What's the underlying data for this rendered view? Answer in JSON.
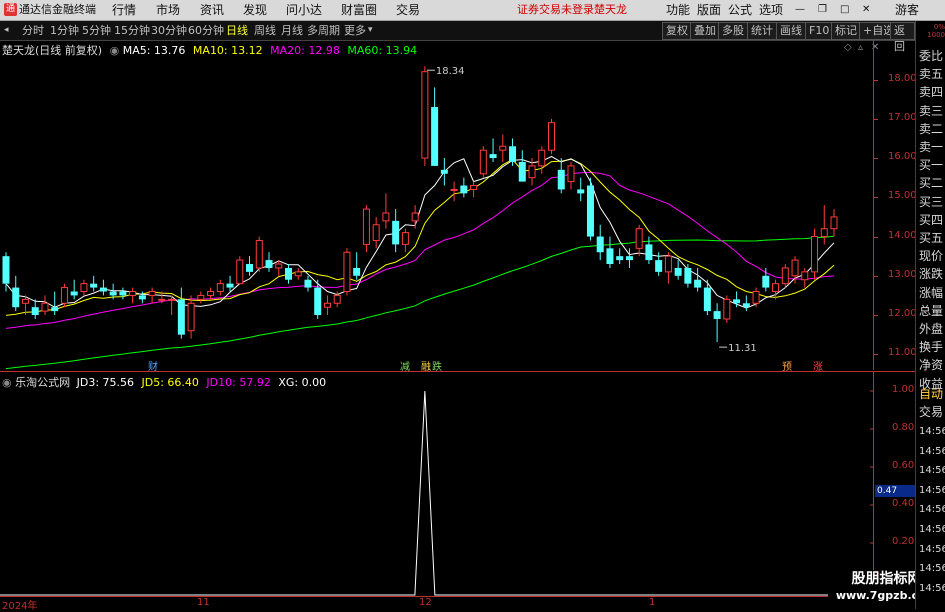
{
  "menubar": {
    "app_title": "通达信金融终端",
    "items": [
      "行情",
      "市场",
      "资讯",
      "发现",
      "问小达",
      "财富圈",
      "交易"
    ],
    "warning": "证券交易未登录",
    "stock": "楚天龙",
    "right_items": [
      "功能",
      "版面",
      "公式",
      "选项"
    ],
    "extra": "游客"
  },
  "toolbar": {
    "periods": [
      "分时",
      "1分钟",
      "5分钟",
      "15分钟",
      "30分钟",
      "60分钟",
      "日线",
      "周线",
      "月线",
      "多周期",
      "更多"
    ],
    "active_period": "日线",
    "right_buttons": [
      "复权",
      "叠加",
      "多股",
      "统计",
      "画线",
      "F10",
      "标记",
      "+自选",
      "返回"
    ]
  },
  "chart_header": {
    "name": "楚天龙(日线 前复权)",
    "ma5": "MA5: 13.76",
    "ma10": "MA10: 13.12",
    "ma20": "MA20: 12.98",
    "ma60": "MA60: 13.94",
    "colors": {
      "ma5": "#ffffff",
      "ma10": "#ffff00",
      "ma20": "#ff00ff",
      "ma60": "#00ff00"
    }
  },
  "indicator_header": {
    "name": "乐淘公式网",
    "jd3": "JD3: 75.56",
    "jd5": "JD5: 66.40",
    "jd10": "JD10: 57.92",
    "xg": "XG: 0.00",
    "colors": {
      "jd3": "#ffffff",
      "jd5": "#ffff00",
      "jd10": "#ff00ff",
      "xg": "#ffffff"
    }
  },
  "price_axis": [
    "18.00",
    "17.00",
    "16.00",
    "15.00",
    "14.00",
    "13.00",
    "12.00",
    "11.00"
  ],
  "indicator_axis": [
    "1.00",
    "0.80",
    "0.60",
    "0.40",
    "0.20"
  ],
  "indicator_current": "0.47",
  "annotations": {
    "high": "18.34",
    "low": "11.31"
  },
  "event_markers": [
    {
      "text": "财",
      "color": "#4fa3ff"
    },
    {
      "text": "减",
      "color": "#7cd95f"
    },
    {
      "text": "融",
      "color": "#ffd24a"
    },
    {
      "text": "跌",
      "color": "#7cd95f"
    },
    {
      "text": "预",
      "color": "#ff9f3c"
    },
    {
      "text": "涨",
      "color": "#ff4040"
    }
  ],
  "date_axis": [
    "2024年",
    "11",
    "12",
    "1"
  ],
  "right_panel": {
    "labels": [
      "委比",
      "卖五",
      "卖四",
      "卖三",
      "卖二",
      "卖一",
      "买一",
      "买二",
      "买三",
      "买四",
      "买五",
      "现价",
      "涨跌",
      "涨幅",
      "总量",
      "外盘",
      "换手",
      "净资",
      "收益"
    ],
    "bottom_labels": [
      "自动",
      "交易"
    ],
    "times": [
      "14:56",
      "14:56",
      "14:56",
      "14:56",
      "14:56",
      "14:56",
      "14:56",
      "14:56",
      "14:56"
    ],
    "top_label": "0%\n1000"
  },
  "watermark": {
    "line1": "股朋指标网",
    "line2": "www.7gpzb.com"
  },
  "chart_data": {
    "type": "candlestick",
    "ylim": [
      10.6,
      18.6
    ],
    "candles": [
      [
        13.5,
        13.6,
        12.6,
        12.8
      ],
      [
        12.7,
        13.0,
        12.1,
        12.2
      ],
      [
        12.3,
        12.5,
        12.0,
        12.4
      ],
      [
        12.2,
        12.4,
        11.9,
        12.0
      ],
      [
        12.1,
        12.5,
        12.0,
        12.3
      ],
      [
        12.2,
        12.6,
        12.0,
        12.1
      ],
      [
        12.3,
        12.8,
        12.2,
        12.7
      ],
      [
        12.6,
        12.9,
        12.4,
        12.5
      ],
      [
        12.6,
        12.9,
        12.5,
        12.8
      ],
      [
        12.8,
        13.0,
        12.6,
        12.7
      ],
      [
        12.7,
        12.9,
        12.5,
        12.6
      ],
      [
        12.6,
        12.8,
        12.4,
        12.5
      ],
      [
        12.6,
        12.7,
        12.4,
        12.5
      ],
      [
        12.5,
        12.7,
        12.3,
        12.6
      ],
      [
        12.5,
        12.6,
        12.3,
        12.4
      ],
      [
        12.5,
        12.7,
        12.3,
        12.6
      ],
      [
        12.4,
        12.6,
        12.3,
        12.4
      ],
      [
        12.4,
        12.5,
        12.0,
        12.4
      ],
      [
        12.4,
        12.7,
        11.4,
        11.5
      ],
      [
        11.6,
        12.5,
        11.4,
        12.3
      ],
      [
        12.4,
        12.6,
        12.3,
        12.5
      ],
      [
        12.5,
        12.7,
        12.4,
        12.6
      ],
      [
        12.6,
        12.9,
        12.5,
        12.8
      ],
      [
        12.8,
        13.0,
        12.6,
        12.7
      ],
      [
        12.8,
        13.5,
        12.8,
        13.4
      ],
      [
        13.3,
        13.5,
        13.0,
        13.1
      ],
      [
        13.2,
        14.0,
        13.1,
        13.9
      ],
      [
        13.4,
        13.6,
        13.1,
        13.2
      ],
      [
        13.2,
        13.4,
        13.0,
        13.3
      ],
      [
        13.2,
        13.3,
        12.8,
        12.9
      ],
      [
        13.0,
        13.2,
        12.9,
        13.1
      ],
      [
        12.9,
        13.0,
        12.6,
        12.7
      ],
      [
        12.7,
        12.9,
        11.9,
        12.0
      ],
      [
        12.2,
        12.5,
        12.0,
        12.3
      ],
      [
        12.3,
        12.6,
        12.2,
        12.5
      ],
      [
        12.6,
        13.7,
        12.5,
        13.6
      ],
      [
        13.2,
        13.6,
        12.9,
        13.0
      ],
      [
        13.8,
        14.8,
        13.6,
        14.7
      ],
      [
        13.9,
        14.5,
        13.7,
        14.3
      ],
      [
        14.4,
        15.1,
        14.2,
        14.6
      ],
      [
        14.4,
        14.7,
        13.6,
        13.8
      ],
      [
        13.8,
        14.2,
        13.6,
        14.1
      ],
      [
        14.4,
        14.8,
        14.2,
        14.6
      ],
      [
        16.0,
        18.34,
        15.8,
        18.2
      ],
      [
        17.3,
        17.8,
        15.8,
        15.8
      ],
      [
        15.7,
        16.0,
        15.3,
        15.6
      ],
      [
        15.2,
        15.4,
        14.9,
        15.2
      ],
      [
        15.3,
        15.5,
        15.0,
        15.1
      ],
      [
        15.2,
        15.4,
        15.0,
        15.3
      ],
      [
        15.6,
        16.3,
        15.5,
        16.2
      ],
      [
        16.1,
        16.5,
        15.9,
        16.0
      ],
      [
        16.2,
        16.6,
        15.9,
        16.3
      ],
      [
        16.3,
        16.5,
        15.8,
        15.9
      ],
      [
        15.9,
        16.2,
        15.4,
        15.4
      ],
      [
        15.5,
        16.0,
        15.3,
        15.8
      ],
      [
        15.8,
        16.3,
        15.6,
        16.2
      ],
      [
        16.2,
        17.0,
        16.1,
        16.9
      ],
      [
        15.7,
        16.0,
        15.1,
        15.2
      ],
      [
        15.4,
        15.9,
        15.2,
        15.8
      ],
      [
        15.2,
        15.5,
        14.9,
        15.1
      ],
      [
        15.3,
        15.5,
        13.9,
        14.0
      ],
      [
        14.0,
        14.3,
        13.4,
        13.6
      ],
      [
        13.7,
        14.0,
        13.2,
        13.3
      ],
      [
        13.5,
        13.7,
        13.3,
        13.4
      ],
      [
        13.5,
        13.7,
        13.2,
        13.4
      ],
      [
        13.7,
        14.3,
        13.5,
        14.2
      ],
      [
        13.8,
        14.0,
        13.3,
        13.4
      ],
      [
        13.4,
        13.6,
        13.0,
        13.1
      ],
      [
        13.1,
        13.6,
        12.8,
        13.5
      ],
      [
        13.2,
        13.4,
        12.9,
        13.0
      ],
      [
        13.2,
        13.3,
        12.7,
        12.8
      ],
      [
        12.9,
        13.2,
        12.6,
        12.7
      ],
      [
        12.7,
        12.9,
        12.0,
        12.1
      ],
      [
        12.1,
        12.3,
        11.31,
        11.9
      ],
      [
        11.9,
        12.5,
        11.8,
        12.4
      ],
      [
        12.4,
        12.6,
        12.2,
        12.3
      ],
      [
        12.3,
        12.5,
        12.1,
        12.2
      ],
      [
        12.3,
        12.7,
        12.2,
        12.6
      ],
      [
        13.0,
        13.2,
        12.6,
        12.7
      ],
      [
        12.6,
        12.9,
        12.4,
        12.8
      ],
      [
        12.8,
        13.3,
        12.7,
        13.2
      ],
      [
        13.0,
        13.5,
        12.8,
        13.4
      ],
      [
        12.9,
        13.2,
        12.7,
        13.1
      ],
      [
        13.1,
        14.2,
        12.9,
        14.0
      ],
      [
        14.0,
        14.8,
        13.8,
        14.2
      ],
      [
        14.2,
        14.7,
        14.0,
        14.5
      ]
    ],
    "indicator_spike": {
      "start": 0.0,
      "peak": 1.0
    }
  }
}
